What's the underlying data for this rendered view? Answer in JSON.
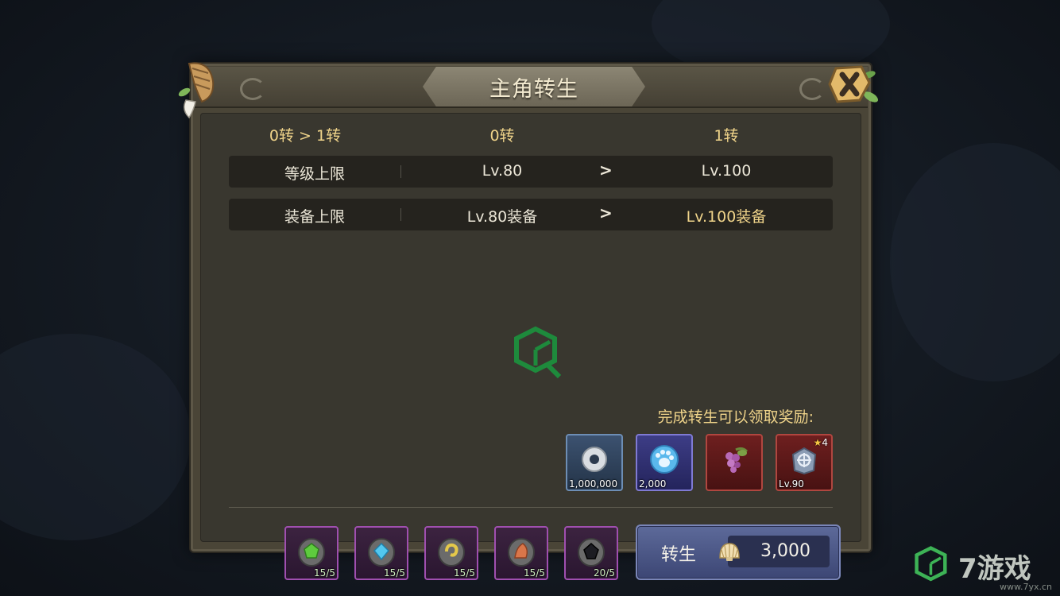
{
  "dialog": {
    "title": "主角转生"
  },
  "header": {
    "transition": "0转 > 1转",
    "current": "0转",
    "next": "1转"
  },
  "rows": [
    {
      "label": "等级上限",
      "current": "Lv.80",
      "arrow": ">",
      "next": "Lv.100"
    },
    {
      "label": "装备上限",
      "current": "Lv.80装备",
      "arrow": ">",
      "next": "Lv.100装备"
    }
  ],
  "rewards": {
    "heading": "完成转生可以领取奖励:",
    "items": [
      {
        "icon": "silver-ring-icon",
        "qty": "1,000,000"
      },
      {
        "icon": "paw-orb-icon",
        "qty": "2,000"
      },
      {
        "icon": "grape-fruit-icon",
        "qty": ""
      },
      {
        "icon": "equipment-armor-icon",
        "qty": "Lv.90",
        "star": "4"
      }
    ]
  },
  "materials": [
    {
      "icon": "green-stone-icon",
      "qty": "15/5"
    },
    {
      "icon": "blue-stone-icon",
      "qty": "15/5"
    },
    {
      "icon": "yellow-stone-icon",
      "qty": "15/5"
    },
    {
      "icon": "orange-stone-icon",
      "qty": "15/5"
    },
    {
      "icon": "black-stone-icon",
      "qty": "20/5"
    }
  ],
  "rebirth_button": {
    "label": "转生",
    "cost": "3,000",
    "currency_icon": "shell-icon"
  },
  "watermark": {
    "brand": "7游戏",
    "url": "www.7yx.cn"
  },
  "colors": {
    "gold_text": "#f0d48a",
    "panel": "#4a4537",
    "button": "#4a5584"
  }
}
